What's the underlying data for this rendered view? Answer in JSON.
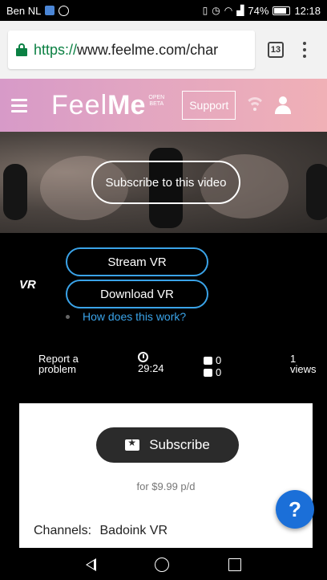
{
  "statusbar": {
    "carrier": "Ben NL",
    "battery": "74%",
    "battery_level": 0.74,
    "time": "12:18",
    "icons": [
      "app-icon",
      "whatsapp-icon",
      "vibrate-icon",
      "alarm-icon",
      "wifi-icon",
      "signal-icon",
      "battery-icon"
    ]
  },
  "browser": {
    "url_scheme": "https://",
    "url_rest": "www.feelme.com/char",
    "tab_count": "13"
  },
  "header": {
    "logo_feel": "Feel",
    "logo_me": "Me",
    "logo_badge_line1": "OPEN",
    "logo_badge_line2": "BETA",
    "support_label": "Support",
    "colors": {
      "gradient_start": "#d79ac8",
      "gradient_end": "#f0b0b6"
    }
  },
  "video": {
    "subscribe_label": "Subscribe to this video"
  },
  "vr": {
    "label": "VR",
    "stream_label": "Stream VR",
    "download_label": "Download VR",
    "how_link": "How does this work?",
    "accent": "#3aa3e8"
  },
  "stats": {
    "report_line1": "Report a",
    "report_line2": "problem",
    "duration": "29:24",
    "likes": "0",
    "dislikes": "0",
    "views_count": "1",
    "views_label": "views"
  },
  "card": {
    "subscribe_label": "Subscribe",
    "price": "for $9.99 p/d",
    "channels_label": "Channels:",
    "channels_value": "Badoink VR"
  },
  "fab": {
    "label": "?"
  }
}
